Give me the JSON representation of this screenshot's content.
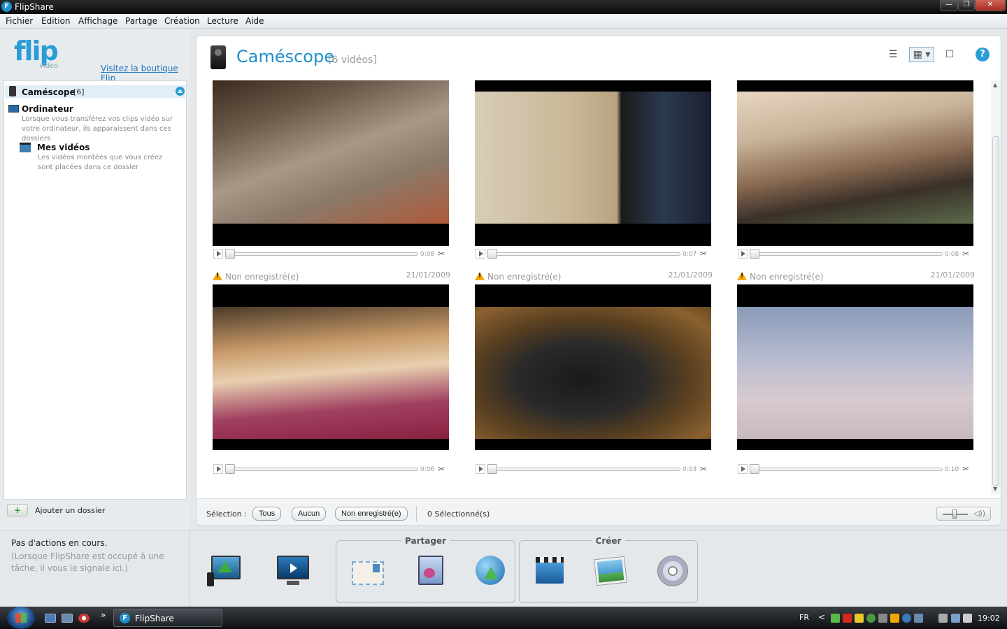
{
  "window": {
    "title": "FlipShare",
    "icon_letter": "F",
    "controls": [
      "minimize-icon",
      "maximize-icon",
      "close-icon"
    ],
    "min_glyph": "—",
    "max_glyph": "❐",
    "close_glyph": "✕"
  },
  "menu": {
    "items": [
      "Fichier",
      "Edition",
      "Affichage",
      "Partage",
      "Création",
      "Lecture",
      "Aide"
    ]
  },
  "sidebar": {
    "logo_text": "flip",
    "logo_sub": "video",
    "shop_link": "Visitez la boutique Flip",
    "camescope": {
      "label": "Caméscope",
      "count": "[6]",
      "eject_glyph": "⏏"
    },
    "ordinateur": {
      "label": "Ordinateur",
      "description": "Lorsque vous transférez vos clips vidéo sur votre ordinateur, ils apparaissent dans ces dossiers"
    },
    "mes_videos": {
      "label": "Mes vidéos",
      "description": "Les vidéos montées que vous créez sont placées dans ce dossier"
    },
    "add_folder": {
      "label": "Ajouter un dossier",
      "icon_glyph": "+"
    }
  },
  "main": {
    "title": "Caméscope",
    "count": "[6 vidéos]",
    "view_glyphs": {
      "list": "☰",
      "grid": "▦ ▾",
      "single": "☐",
      "help": "?"
    },
    "videos": [
      {
        "status": "",
        "date": "",
        "duration": "0:08",
        "scene": "laptop"
      },
      {
        "status": "",
        "date": "",
        "duration": "0:07",
        "scene": "lamp"
      },
      {
        "status": "",
        "date": "",
        "duration": "0:08",
        "scene": "office"
      },
      {
        "status": "Non enregistré(e)",
        "date": "21/01/2009",
        "duration": "0:06",
        "scene": "desk"
      },
      {
        "status": "Non enregistré(e)",
        "date": "21/01/2009",
        "duration": "0:03",
        "scene": "helmet"
      },
      {
        "status": "Non enregistré(e)",
        "date": "21/01/2009",
        "duration": "0:10",
        "scene": "building"
      }
    ],
    "scissors_glyph": "✂",
    "scroll_up_glyph": "▲",
    "scroll_down_glyph": "▼"
  },
  "selection": {
    "label": "Sélection :",
    "all": "Tous",
    "none": "Aucun",
    "unsaved": "Non enregistré(e)",
    "count": "0 Sélectionné(s)",
    "volume_glyph": "◁))"
  },
  "status": {
    "main": "Pas d'actions en cours.",
    "sub": "(Lorsque FlipShare est occupé à une tâche, il vous le signale ici.)"
  },
  "actions": {
    "share_title": "Partager",
    "create_title": "Créer"
  },
  "taskbar": {
    "more_glyph": "»",
    "app_label": "FlipShare",
    "app_icon_letter": "F",
    "lang": "FR",
    "chevron": "<",
    "clock": "19:02"
  }
}
